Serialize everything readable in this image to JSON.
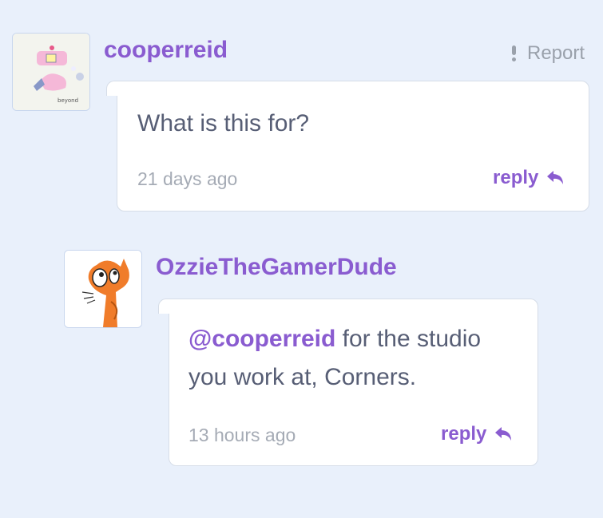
{
  "comments": [
    {
      "username": "cooperreid",
      "report_label": "Report",
      "text": "What is this for?",
      "time": "21 days ago",
      "reply_label": "reply",
      "avatar_caption": "beyond"
    },
    {
      "username": "OzzieTheGamerDude",
      "mention": "@cooperreid",
      "text_line1": " for the studio",
      "text_line2": "you work at, Corners.",
      "time": "13 hours ago",
      "reply_label": "reply"
    }
  ],
  "colors": {
    "background": "#e9f0fb",
    "accent": "#8a5cd0",
    "text": "#575e75",
    "muted": "#a5abb5"
  },
  "icons": [
    "exclamation-icon",
    "reply-arrow-icon"
  ]
}
